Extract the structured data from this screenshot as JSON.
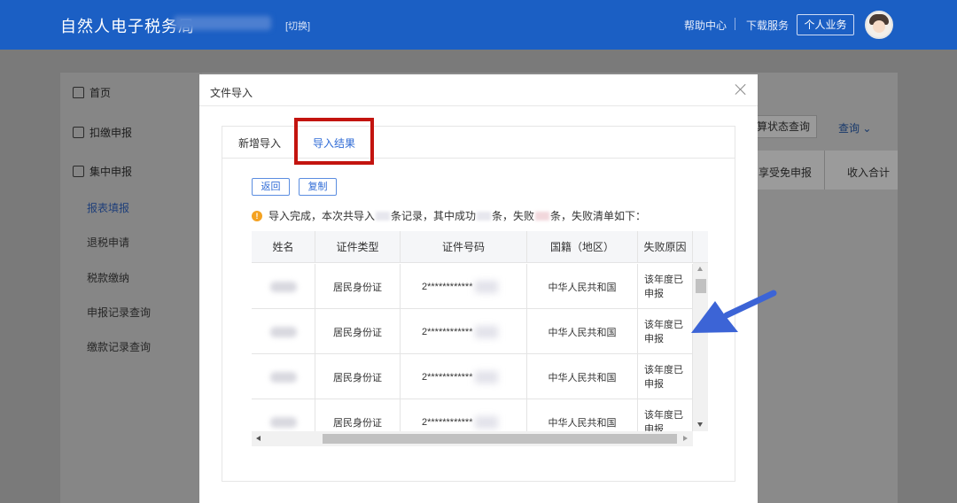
{
  "header": {
    "title": "自然人电子税务局",
    "switch_label": "[切换]",
    "help_label": "帮助中心",
    "download_label": "下载服务",
    "personal_label": "个人业务"
  },
  "sidebar": {
    "items": [
      {
        "label": "首页",
        "icon": "home-icon"
      },
      {
        "label": "扣缴申报",
        "icon": "document-icon"
      },
      {
        "label": "集中申报",
        "icon": "upload-icon"
      }
    ],
    "subitems": [
      "报表填报",
      "退税申请",
      "税款缴纳",
      "申报记录查询",
      "缴款记录查询"
    ]
  },
  "background": {
    "status_query_button": "算状态查询",
    "query_link": "查询",
    "tab_exempt": "享受免申报",
    "tab_income": "收入合计"
  },
  "modal": {
    "title": "文件导入",
    "tabs": [
      {
        "label": "新增导入",
        "active": false
      },
      {
        "label": "导入结果",
        "active": true
      }
    ],
    "back_button": "返回",
    "copy_button": "复制",
    "notice_part1": "导入完成，本次共导入",
    "notice_part2": "条记录，其中成功",
    "notice_part3": "条，失败",
    "notice_part4": "条，失败清单如下：",
    "table": {
      "headers": [
        "姓名",
        "证件类型",
        "证件号码",
        "国籍（地区）",
        "失败原因"
      ],
      "rows": [
        {
          "id_type": "居民身份证",
          "id_number": "2************",
          "nationality": "中华人民共和国",
          "reason": "该年度已申报"
        },
        {
          "id_type": "居民身份证",
          "id_number": "2************",
          "nationality": "中华人民共和国",
          "reason": "该年度已申报"
        },
        {
          "id_type": "居民身份证",
          "id_number": "2************",
          "nationality": "中华人民共和国",
          "reason": "该年度已申报"
        },
        {
          "id_type": "居民身份证",
          "id_number": "2************",
          "nationality": "中华人民共和国",
          "reason": "该年度已申报"
        }
      ]
    }
  },
  "colors": {
    "header_blue": "#1b5fc4",
    "highlight_red": "#c3140f",
    "arrow_blue": "#3c64d6",
    "link_blue": "#2f6bd6",
    "warning_orange": "#f4a222"
  }
}
